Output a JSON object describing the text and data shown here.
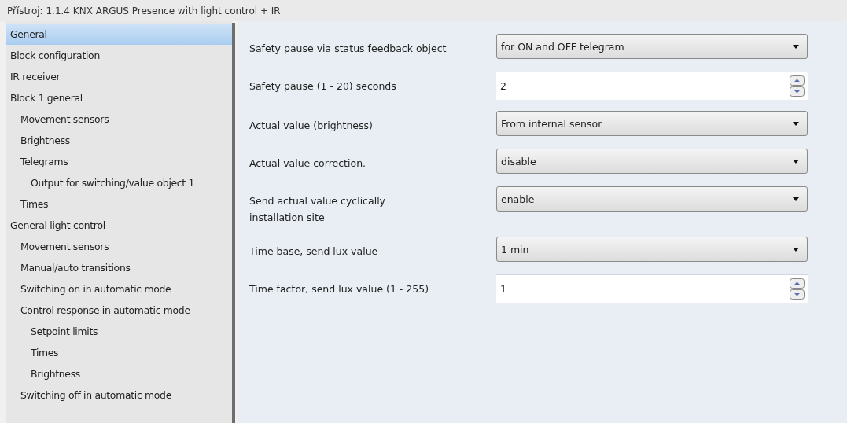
{
  "window": {
    "title": "Přístroj: 1.1.4  KNX ARGUS Presence with light control + IR"
  },
  "sidebar": {
    "items": [
      {
        "label": "General",
        "selected": true
      },
      {
        "label": "Block configuration",
        "selected": false
      },
      {
        "label": "IR receiver",
        "selected": false
      },
      {
        "label": "Block 1 general",
        "selected": false,
        "children": [
          {
            "label": "Movement sensors",
            "selected": false
          },
          {
            "label": "Brightness",
            "selected": false
          },
          {
            "label": "Telegrams",
            "selected": false,
            "children": [
              {
                "label": "Output for switching/value object 1",
                "selected": false
              }
            ]
          },
          {
            "label": "Times",
            "selected": false
          }
        ]
      },
      {
        "label": "General light control",
        "selected": false,
        "children": [
          {
            "label": "Movement sensors",
            "selected": false
          },
          {
            "label": "Manual/auto transitions",
            "selected": false
          },
          {
            "label": "Switching on in automatic mode",
            "selected": false
          },
          {
            "label": "Control response in automatic mode",
            "selected": false,
            "children": [
              {
                "label": "Setpoint limits",
                "selected": false
              },
              {
                "label": "Times",
                "selected": false
              },
              {
                "label": "Brightness",
                "selected": false
              }
            ]
          },
          {
            "label": "Switching off in automatic mode",
            "selected": false
          }
        ]
      }
    ]
  },
  "parameters": [
    {
      "label": "Safety pause via status feedback object",
      "kind": "dropdown",
      "value": "for ON and OFF telegram"
    },
    {
      "label": "Safety pause (1 - 20) seconds",
      "kind": "spin",
      "value": "2"
    },
    {
      "label": "Actual value (brightness)",
      "kind": "dropdown",
      "value": "From internal sensor"
    },
    {
      "label": "Actual value correction.",
      "kind": "dropdown",
      "value": "disable"
    },
    {
      "label": "Send actual value cyclically\ninstallation site",
      "kind": "dropdown",
      "value": "enable"
    },
    {
      "label": "Time base, send lux value",
      "kind": "dropdown",
      "value": "1 min"
    },
    {
      "label": "Time factor, send lux value (1 - 255)",
      "kind": "spin",
      "value": "1"
    }
  ]
}
